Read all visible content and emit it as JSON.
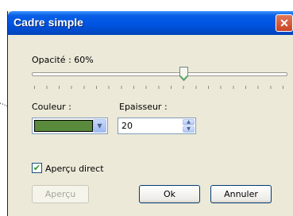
{
  "dialog": {
    "title": "Cadre simple",
    "close_glyph": "✕"
  },
  "opacity": {
    "label": "Opacité : 60%",
    "value_percent": 60
  },
  "color": {
    "label": "Couleur :",
    "swatch_color": "#5a8a3c"
  },
  "thickness": {
    "label": "Epaisseur :",
    "value": "20"
  },
  "preview_checkbox": {
    "label": "Aperçu direct",
    "checked": true
  },
  "buttons": {
    "preview": "Aperçu",
    "ok": "Ok",
    "cancel": "Annuler"
  },
  "icons": {
    "dropdown": "chevron-down-icon",
    "spin_up": "spin-up-icon",
    "spin_down": "spin-down-icon",
    "close": "close-icon"
  }
}
